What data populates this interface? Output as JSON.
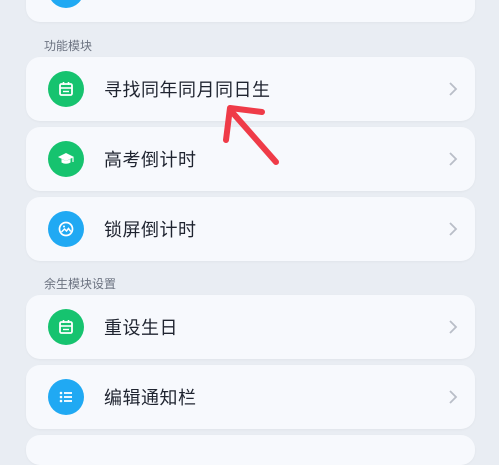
{
  "sections": {
    "modules": "功能模块",
    "life": "余生模块设置"
  },
  "rows": {
    "find_birthday": "寻找同年同月同日生",
    "gaokao_countdown": "高考倒计时",
    "lockscreen_countdown": "锁屏倒计时",
    "reset_birthday": "重设生日",
    "edit_notification": "编辑通知栏"
  },
  "colors": {
    "green": "#16c36f",
    "blue": "#20a9f3",
    "arrow": "#ef3b48"
  },
  "icons": {
    "find_birthday": "calendar-icon",
    "gaokao_countdown": "graduation-cap-icon",
    "lockscreen_countdown": "image-icon",
    "reset_birthday": "calendar-icon",
    "edit_notification": "list-icon"
  }
}
